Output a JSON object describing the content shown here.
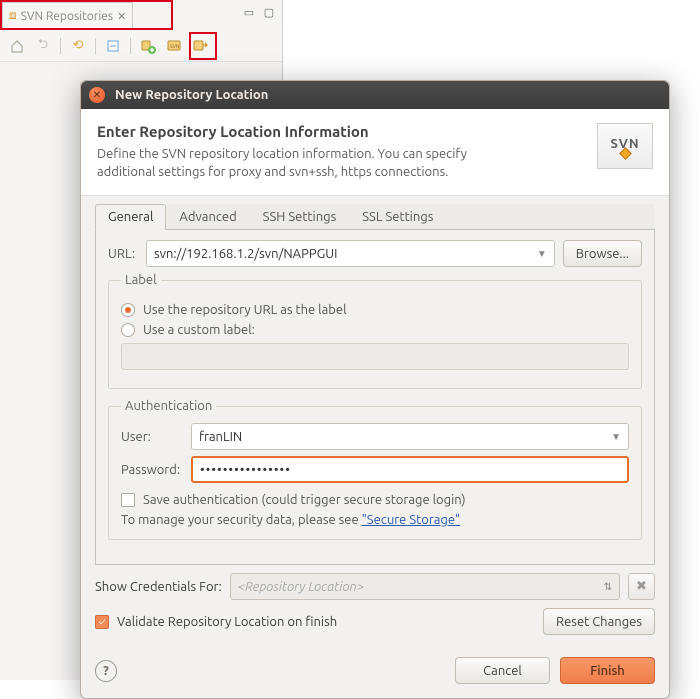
{
  "view": {
    "tab_label": "SVN Repositories"
  },
  "toolbar": {
    "home": "home-icon",
    "back": "back-icon",
    "fwd": "fwd-icon",
    "refresh": "refresh-icon",
    "collapse": "collapse-icon",
    "new_repo": "new-repo-location-icon",
    "svn": "svn-icon",
    "checkout": "checkout-icon"
  },
  "dialog": {
    "title": "New Repository Location",
    "heading": "Enter Repository Location Information",
    "description": "Define the SVN repository location information. You can specify additional settings for proxy and svn+ssh, https connections.",
    "badge": "SVN",
    "tabs": {
      "general": "General",
      "advanced": "Advanced",
      "ssh": "SSH Settings",
      "ssl": "SSL Settings"
    },
    "url_label": "URL:",
    "url_value": "svn://192.168.1.2/svn/NAPPGUI",
    "browse": "Browse...",
    "label_fs": {
      "legend": "Label",
      "opt_url": "Use the repository URL as the label",
      "opt_custom": "Use a custom label:"
    },
    "auth_fs": {
      "legend": "Authentication",
      "user_label": "User:",
      "user_value": "franLIN",
      "pass_label": "Password:",
      "pass_value": "••••••••••••••••",
      "save": "Save authentication (could trigger secure storage login)",
      "manage_pre": "To manage your security data, please see ",
      "manage_link": "\"Secure Storage\""
    },
    "show_label": "Show Credentials For:",
    "show_placeholder": "<Repository Location>",
    "validate": "Validate Repository Location on finish",
    "reset": "Reset Changes",
    "cancel": "Cancel",
    "finish": "Finish"
  }
}
